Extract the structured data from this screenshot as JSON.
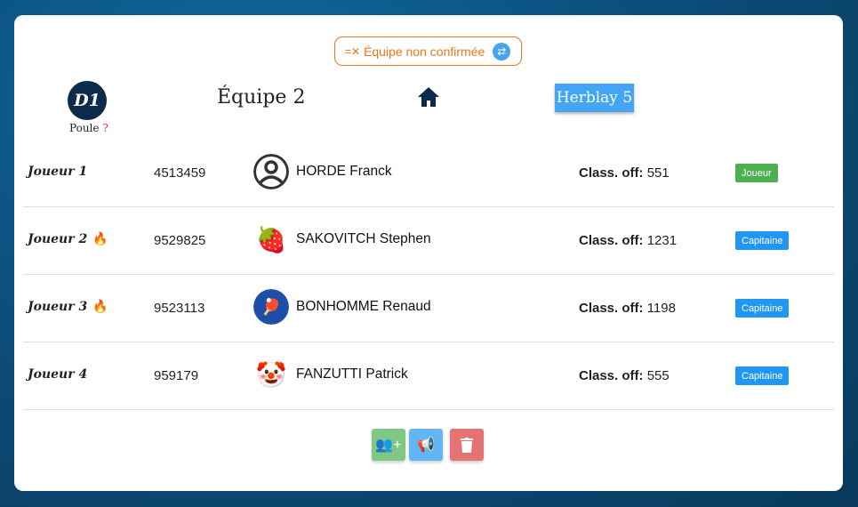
{
  "status": {
    "label": "Équipe non confirmée",
    "icon": "unconfirmed-icon",
    "action_icon": "swap-icon"
  },
  "division": {
    "label": "D1",
    "poule_label": "Poule",
    "poule_value": "?"
  },
  "team": {
    "name": "Équipe 2"
  },
  "location": {
    "icon": "home-icon"
  },
  "opponent": {
    "name": "Herblay 5"
  },
  "players": [
    {
      "label": "Joueur 1",
      "license": "4513459",
      "name": "HORDE Franck",
      "class_label": "Class. off:",
      "points": "551",
      "role": "Joueur",
      "role_color": "#4caf50",
      "flame": false,
      "avatar": "default-avatar"
    },
    {
      "label": "Joueur 2",
      "license": "9529825",
      "name": "SAKOVITCH Stephen",
      "class_label": "Class. off:",
      "points": "1231",
      "role": "Capitaine",
      "role_color": "#2196f3",
      "flame": true,
      "avatar": "strawberry"
    },
    {
      "label": "Joueur 3",
      "license": "9523113",
      "name": "BONHOMME Renaud",
      "class_label": "Class. off:",
      "points": "1198",
      "role": "Capitaine",
      "role_color": "#2196f3",
      "flame": true,
      "avatar": "ping-pong-badge"
    },
    {
      "label": "Joueur 4",
      "license": "959179",
      "name": "FANZUTTI Patrick",
      "class_label": "Class. off:",
      "points": "555",
      "role": "Capitaine",
      "role_color": "#2196f3",
      "flame": false,
      "avatar": "clown"
    }
  ],
  "actions": [
    {
      "name": "add-player-button",
      "icon": "user-plus-icon",
      "color": "#81c784"
    },
    {
      "name": "notify-button",
      "icon": "megaphone-icon",
      "color": "#64b5f6"
    },
    {
      "name": "delete-button",
      "icon": "trash-icon",
      "color": "#e57373"
    }
  ]
}
